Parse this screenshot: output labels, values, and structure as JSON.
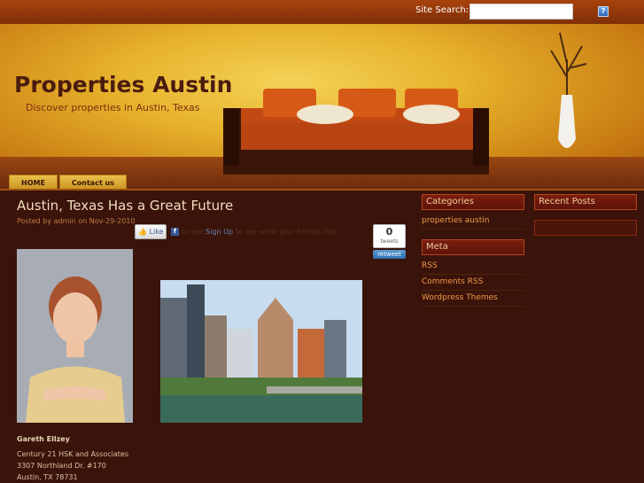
{
  "topbar": {
    "search_label": "Site Search:",
    "search_value": "",
    "search_button_label": "?"
  },
  "header": {
    "site_title": "Properties Austin",
    "tagline": "Discover properties in Austin, Texas"
  },
  "nav": {
    "items": [
      {
        "label": "HOME"
      },
      {
        "label": "Contact us"
      }
    ]
  },
  "post": {
    "title": "Austin, Texas Has a Great Future",
    "meta": "Posted by admin on Nov-29-2010",
    "like_label": "Like",
    "fb_prefix": "to see",
    "fb_signup": "Sign Up",
    "fb_suffix": "to see what your friends like.",
    "tweet_count": "0",
    "tweet_label": "tweets",
    "retweet_label": "retweet",
    "agent": {
      "name": "Gareth Ellzey",
      "company": "Century 21 HSK and Associates",
      "street": "3307 Northland Dr. #170",
      "city": "Austin, TX 78731"
    }
  },
  "sidebar": {
    "categories_title": "Categories",
    "categories": [
      {
        "label": "properties austin"
      }
    ],
    "meta_title": "Meta",
    "meta_links": [
      {
        "label": "RSS"
      },
      {
        "label": "Comments RSS"
      },
      {
        "label": "Wordpress Themes"
      }
    ],
    "recent_title": "Recent Posts"
  },
  "colors": {
    "background": "#3a130a",
    "title_text": "#f1dfbe",
    "link": "#f09a4a",
    "header_gold": "#e7b22c"
  }
}
